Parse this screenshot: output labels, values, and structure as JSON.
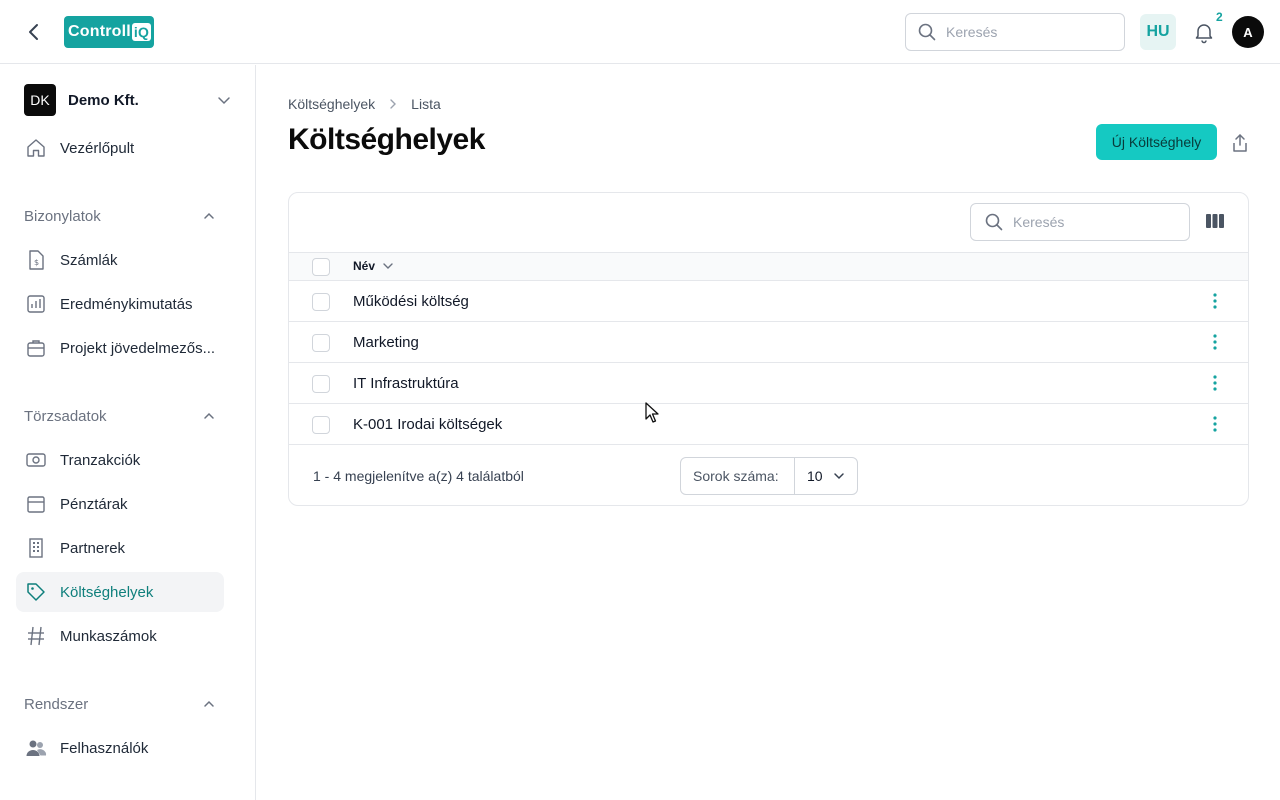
{
  "header": {
    "logo_text": "Controll",
    "logo_suffix": "iQ",
    "search_placeholder": "Keresés",
    "language": "HU",
    "notification_count": "2",
    "avatar_initial": "A"
  },
  "sidebar": {
    "org": {
      "initials": "DK",
      "name": "Demo Kft."
    },
    "dashboard": "Vezérlőpult",
    "sections": [
      {
        "title": "Bizonylatok",
        "items": [
          "Számlák",
          "Eredménykimutatás",
          "Projekt jövedelmezős..."
        ]
      },
      {
        "title": "Törzsadatok",
        "items": [
          "Tranzakciók",
          "Pénztárak",
          "Partnerek",
          "Költséghelyek",
          "Munkaszámok"
        ]
      },
      {
        "title": "Rendszer",
        "items": [
          "Felhasználók"
        ]
      }
    ],
    "active_item": "Költséghelyek"
  },
  "breadcrumb": [
    "Költséghelyek",
    "Lista"
  ],
  "page_title": "Költséghelyek",
  "new_button": "Új Költséghely",
  "table": {
    "search_placeholder": "Keresés",
    "column_name": "Név",
    "rows": [
      "Működési költség",
      "Marketing",
      "IT Infrastruktúra",
      "K-001 Irodai költségek"
    ],
    "footer_info": "1 - 4 megjelenítve a(z) 4 találatból",
    "rows_per_page_label": "Sorok száma:",
    "rows_per_page_value": "10"
  },
  "colors": {
    "accent": "#15a3a0",
    "button": "#15c9c2",
    "active_text": "#0f7f7c"
  }
}
